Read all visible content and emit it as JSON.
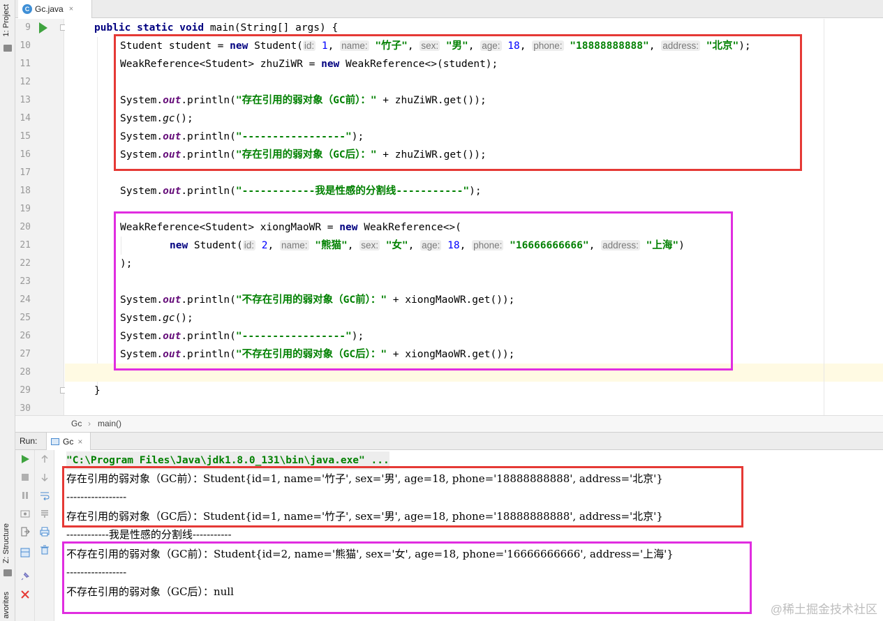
{
  "editor": {
    "tab_label": "Gc.java",
    "tab_icon": "C",
    "tab_close": "×",
    "line_numbers": [
      "9",
      "10",
      "11",
      "12",
      "13",
      "14",
      "15",
      "16",
      "17",
      "18",
      "19",
      "20",
      "21",
      "22",
      "23",
      "24",
      "25",
      "26",
      "27",
      "28",
      "29",
      "30"
    ]
  },
  "code": {
    "l9": {
      "kw": "public static void",
      "rest": " main(String[] args) {"
    },
    "l10": {
      "a": "Student student = ",
      "new": "new",
      "b": " Student(",
      "h_id": "id:",
      "v_id": "1",
      "h_name": "name:",
      "v_name": "\"竹子\"",
      "h_sex": "sex:",
      "v_sex": "\"男\"",
      "h_age": "age:",
      "v_age": "18",
      "h_phone": "phone:",
      "v_phone": "\"18888888888\"",
      "h_address": "address:",
      "v_address": "\"北京\"",
      "end": ");"
    },
    "l11": {
      "a": "WeakReference<Student> zhuZiWR = ",
      "new": "new",
      "b": " WeakReference<>(student);"
    },
    "l13": {
      "a": "System.",
      "out": "out",
      "b": ".println(",
      "s": "\"存在引用的弱对象（GC前）：\"",
      "c": " + zhuZiWR.get());"
    },
    "l14": {
      "a": "System.",
      "gc": "gc",
      "b": "();"
    },
    "l15": {
      "a": "System.",
      "out": "out",
      "b": ".println(",
      "s": "\"-----------------\"",
      "c": ");"
    },
    "l16": {
      "a": "System.",
      "out": "out",
      "b": ".println(",
      "s": "\"存在引用的弱对象（GC后）：\"",
      "c": " + zhuZiWR.get());"
    },
    "l18": {
      "a": "System.",
      "out": "out",
      "b": ".println(",
      "s": "\"------------我是性感的分割线-----------\"",
      "c": ");"
    },
    "l20": {
      "a": "WeakReference<Student> xiongMaoWR = ",
      "new": "new",
      "b": " WeakReference<>("
    },
    "l21": {
      "new": "new",
      "b": " Student(",
      "h_id": "id:",
      "v_id": "2",
      "h_name": "name:",
      "v_name": "\"熊猫\"",
      "h_sex": "sex:",
      "v_sex": "\"女\"",
      "h_age": "age:",
      "v_age": "18",
      "h_phone": "phone:",
      "v_phone": "\"16666666666\"",
      "h_address": "address:",
      "v_address": "\"上海\"",
      "end": ")"
    },
    "l22": {
      "a": ");"
    },
    "l24": {
      "a": "System.",
      "out": "out",
      "b": ".println(",
      "s": "\"不存在引用的弱对象（GC前）：\"",
      "c": " + xiongMaoWR.get());"
    },
    "l25": {
      "a": "System.",
      "gc": "gc",
      "b": "();"
    },
    "l26": {
      "a": "System.",
      "out": "out",
      "b": ".println(",
      "s": "\"-----------------\"",
      "c": ");"
    },
    "l27": {
      "a": "System.",
      "out": "out",
      "b": ".println(",
      "s": "\"不存在引用的弱对象（GC后）：\"",
      "c": " + xiongMaoWR.get());"
    },
    "l29": {
      "a": "}"
    }
  },
  "breadcrumb": {
    "class": "Gc",
    "sep": "›",
    "method": "main()"
  },
  "run_panel": {
    "label": "Run:",
    "tab_label": "Gc",
    "tab_close": "×"
  },
  "console": {
    "cmd": "\"C:\\Program Files\\Java\\jdk1.8.0_131\\bin\\java.exe\" ...",
    "lines": [
      "存在引用的弱对象（GC前）：Student{id=1, name='竹子', sex='男', age=18, phone='18888888888', address='北京'}",
      "-----------------",
      "存在引用的弱对象（GC后）：Student{id=1, name='竹子', sex='男', age=18, phone='18888888888', address='北京'}",
      "------------我是性感的分割线-----------",
      "不存在引用的弱对象（GC前）：Student{id=2, name='熊猫', sex='女', age=18, phone='16666666666', address='上海'}",
      "-----------------",
      "不存在引用的弱对象（GC后）：null"
    ]
  },
  "side_tabs": {
    "project": "1: Project",
    "structure": "Z: Structure",
    "favorites": "avorites"
  },
  "watermark": "@稀土掘金技术社区",
  "colors": {
    "red_box": "#e53935",
    "magenta_box": "#e02de0",
    "keyword": "#000080",
    "string": "#008000",
    "static_field": "#660e7a"
  }
}
